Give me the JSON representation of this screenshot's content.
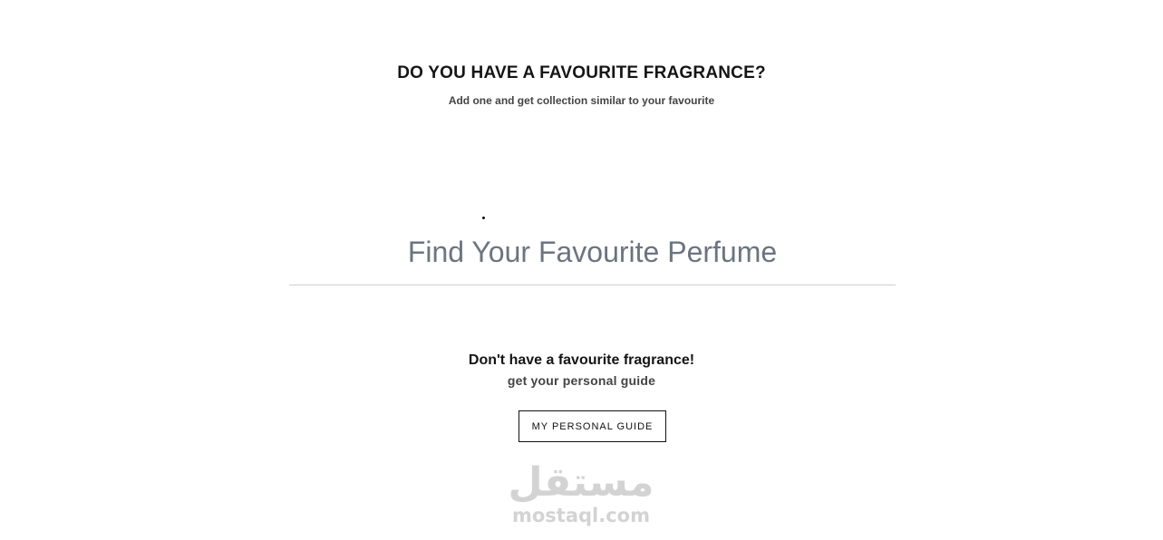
{
  "header": {
    "title": "DO YOU HAVE A FAVOURITE FRAGRANCE?",
    "subtitle": "Add one and get collection similar to your favourite"
  },
  "search": {
    "value": "",
    "placeholder": "Find Your Favourite Perfume"
  },
  "guide": {
    "title": "Don't have a favourite fragrance!",
    "subtitle": "get your personal guide",
    "button_label": "MY PERSONAL GUIDE"
  },
  "watermark": {
    "arabic": "مستقل",
    "latin": "mostaql.com"
  }
}
